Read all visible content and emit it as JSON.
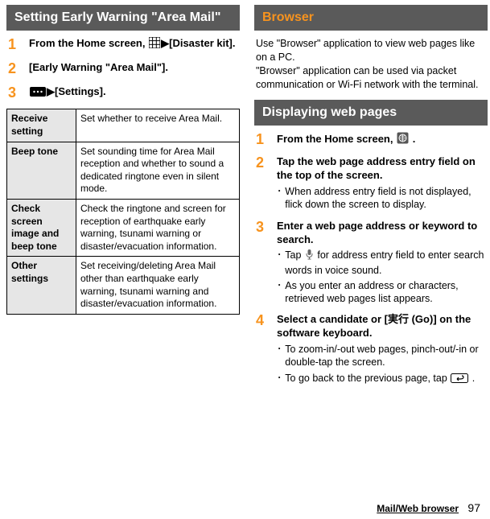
{
  "left": {
    "header": "Setting Early Warning \"Area Mail\"",
    "steps": [
      {
        "num": "1",
        "title_parts": [
          "From the Home screen, ",
          "ICON_GRID",
          "▶",
          "[Disaster kit]."
        ]
      },
      {
        "num": "2",
        "title_parts": [
          "[",
          "Early Warning \"Area Mail\"",
          "]."
        ]
      },
      {
        "num": "3",
        "title_parts": [
          "ICON_MENU",
          "▶",
          "[Settings]."
        ]
      }
    ],
    "table": [
      {
        "label": "Receive setting",
        "desc": "Set whether to receive Area Mail."
      },
      {
        "label": "Beep tone",
        "desc": "Set sounding time for Area Mail reception and whether to sound a dedicated ringtone even in silent mode."
      },
      {
        "label": "Check screen image and beep tone",
        "desc": "Check the ringtone and screen for reception of earthquake early warning, tsunami warning or disaster/evacuation information."
      },
      {
        "label": "Other settings",
        "desc": "Set receiving/deleting Area Mail other than earthquake early warning, tsunami warning and disaster/evacuation information."
      }
    ]
  },
  "right": {
    "header": "Browser",
    "intro": "Use \"Browser\" application to view web pages like on a PC.\n\"Browser\" application can be used via packet communication or Wi-Fi network with the terminal.",
    "subheader": "Displaying web pages",
    "steps": [
      {
        "num": "1",
        "title": "From the Home screen, ",
        "title_suffix_icon": "ICON_GLOBE",
        "title_end": " .",
        "bullets": []
      },
      {
        "num": "2",
        "title": "Tap the web page address entry field on the top of the screen.",
        "bullets": [
          "When address entry field is not displayed, flick down the screen to display."
        ]
      },
      {
        "num": "3",
        "title": "Enter a web page address or keyword to search.",
        "bullets": [
          {
            "pre": "Tap ",
            "icon": "ICON_MIC",
            "post": " for address entry field to enter search words in voice sound."
          },
          "As you enter an address or characters, retrieved web pages list appears."
        ]
      },
      {
        "num": "4",
        "title": "Select a candidate or [実行 (Go)] on the software keyboard.",
        "bullets": [
          "To zoom-in/-out web pages, pinch-out/-in or double-tap the screen.",
          {
            "pre": "To go back to the previous page, tap ",
            "icon": "ICON_BACK",
            "post": " ."
          }
        ]
      }
    ]
  },
  "footer": {
    "section": "Mail/Web browser",
    "page": "97"
  },
  "glyphs": {
    "arrow": "▶",
    "bullet": "･"
  }
}
